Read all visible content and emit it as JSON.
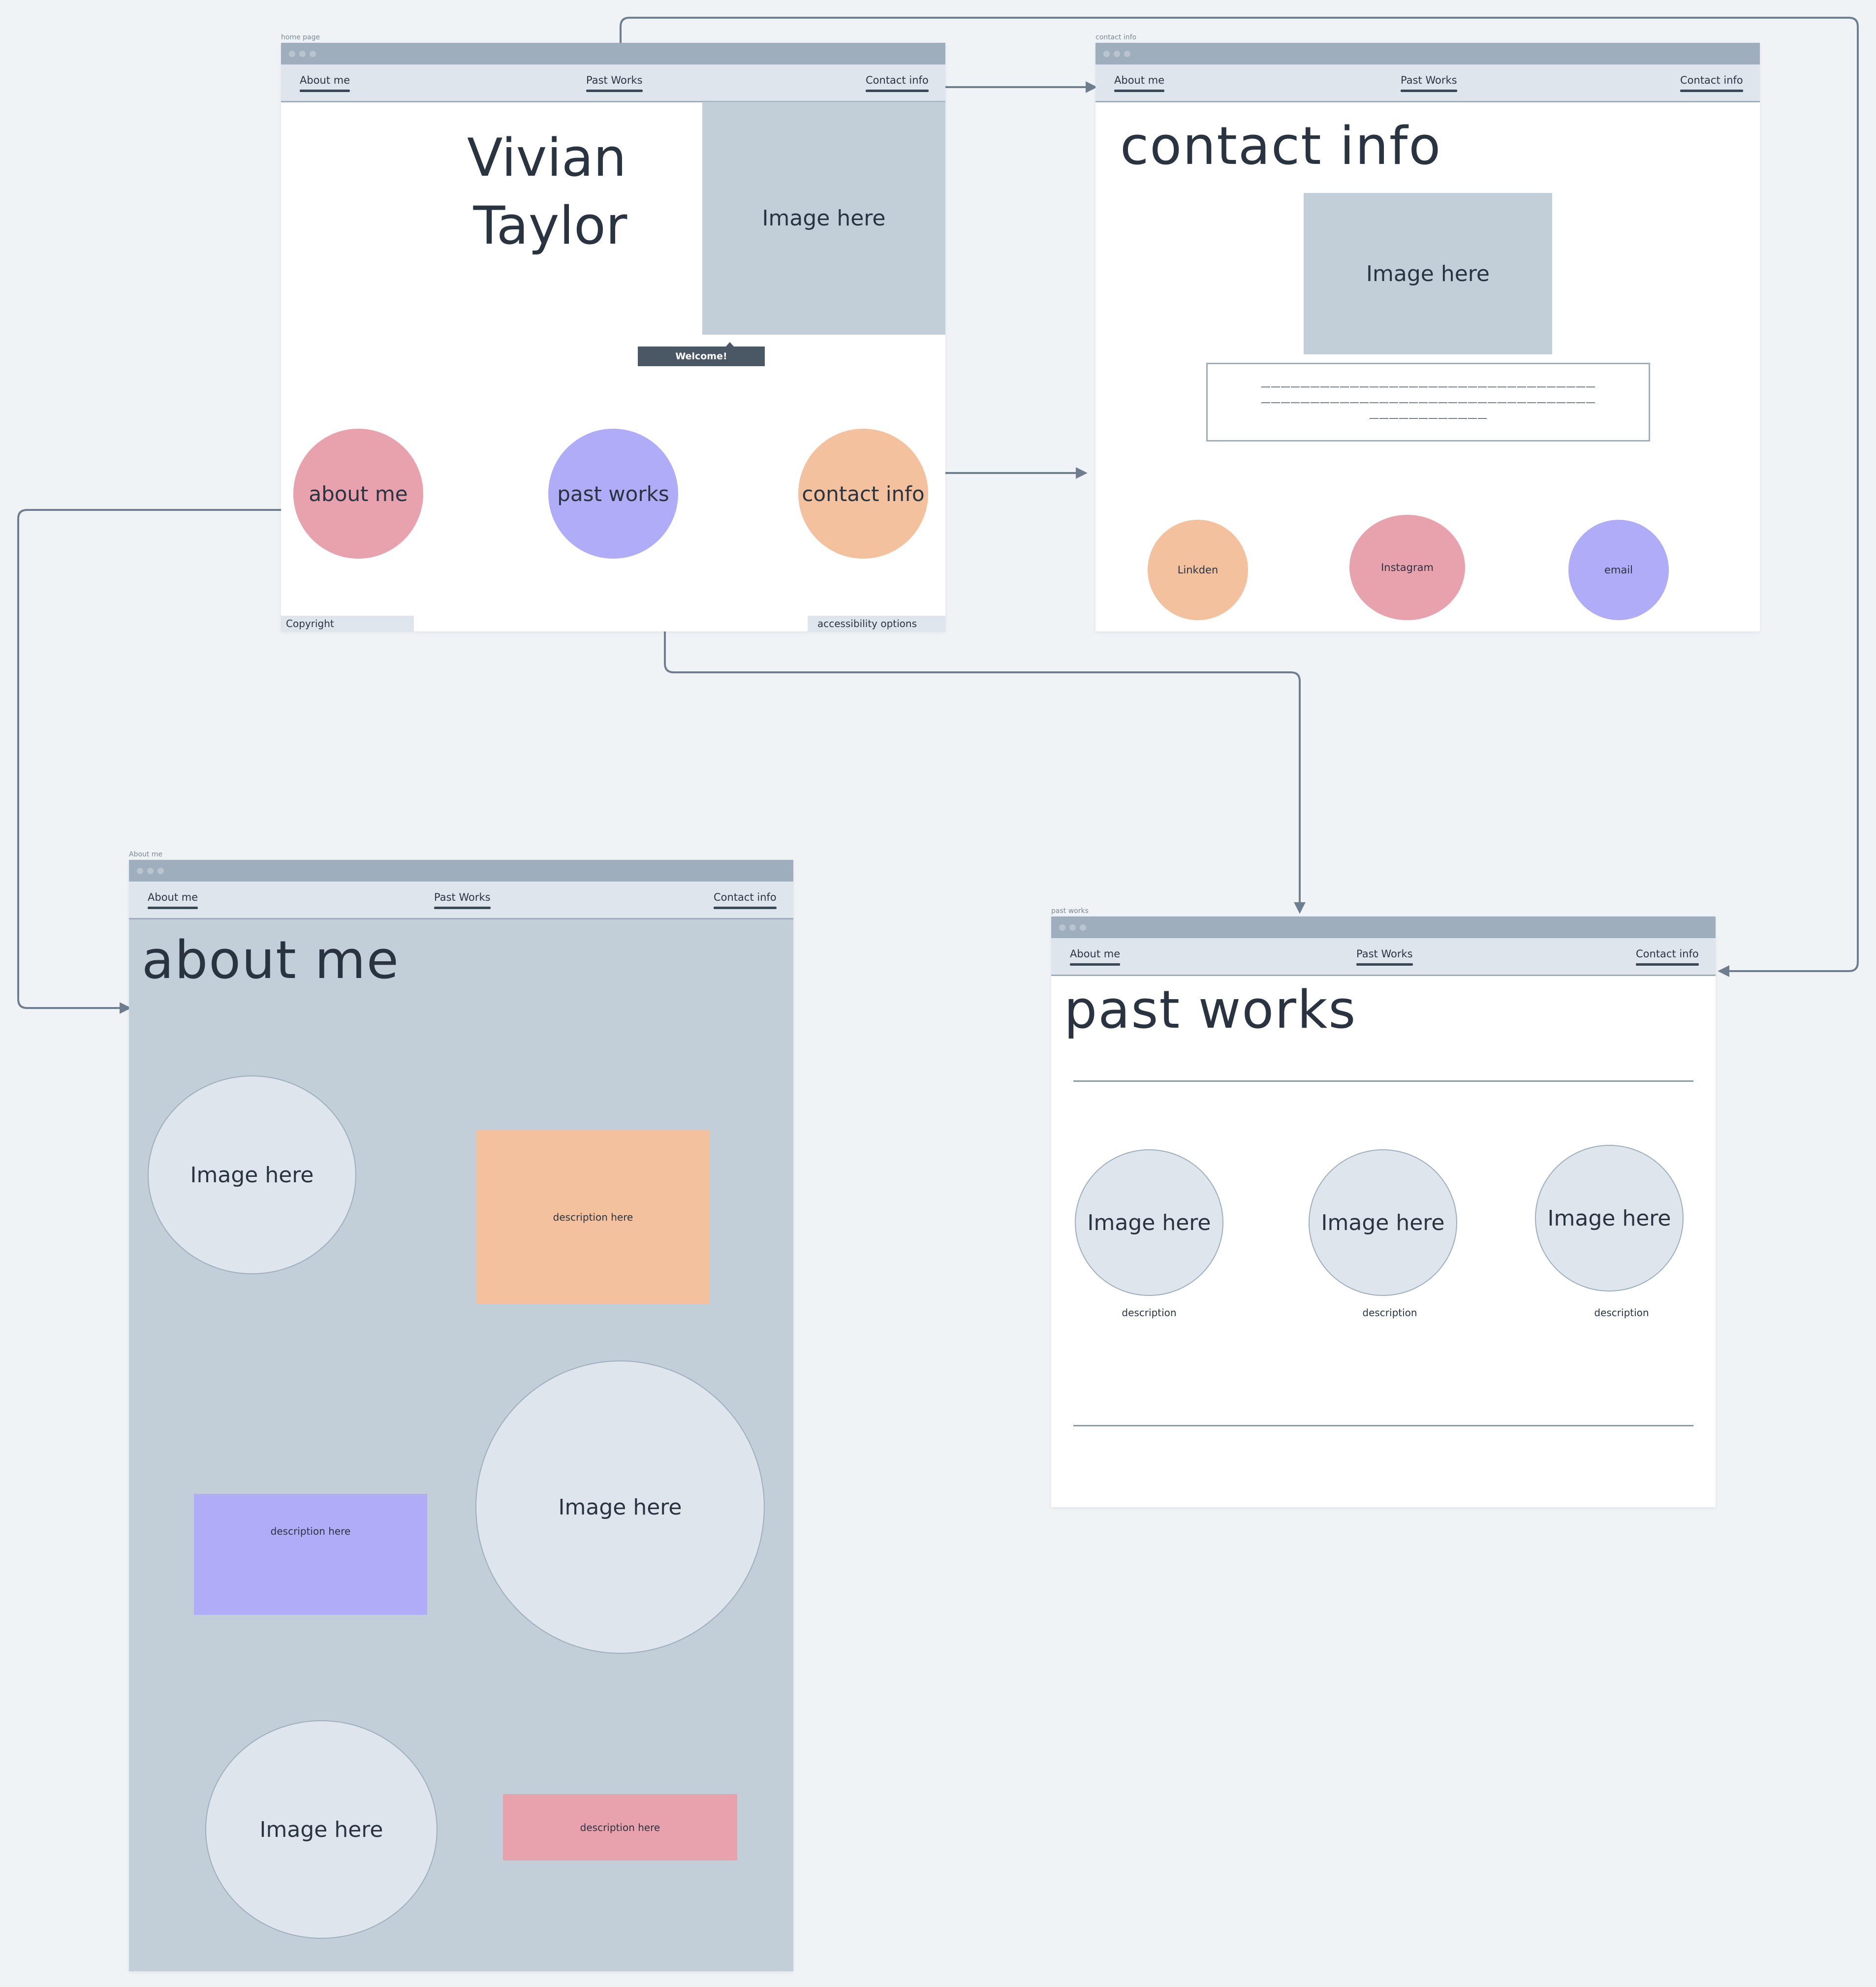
{
  "colors": {
    "canvas": "#eff3f6",
    "titlebar": "#9eaebc",
    "navbar": "#dfe5ec",
    "image_placeholder": "#c3cfd8",
    "image_circle": "#dfe5ec",
    "pink": "#e8a2ad",
    "purple": "#b1acf8",
    "orange": "#f3c19e",
    "connector": "#6e7e8e"
  },
  "nav": {
    "about": "About me",
    "past": "Past Works",
    "contact": "Contact info"
  },
  "home": {
    "frame_label": "home page",
    "name_line1": "Vivian",
    "name_line2": "Taylor",
    "image": "Image here",
    "welcome": "Welcome!",
    "circle_about": "about me",
    "circle_past": "past works",
    "circle_contact": "contact info",
    "copyright": "Copyright",
    "accessibility": "accessibility options"
  },
  "contact": {
    "frame_label": "contact info",
    "heading": "contact info",
    "image": "Image here",
    "text_line1": "——————————————————————————————————",
    "text_line2": "——————————————————————————————————",
    "text_line3": "————————————",
    "linkedin": "Linkden",
    "instagram": "Instagram",
    "email": "email"
  },
  "about": {
    "frame_label": "About me",
    "heading": "about me",
    "image1": "Image here",
    "image2": "Image here",
    "image3": "Image here",
    "desc1": "description here",
    "desc2": "description here",
    "desc3": "description here"
  },
  "past": {
    "frame_label": "past works",
    "heading": "past works",
    "image1": "Image here",
    "image2": "Image here",
    "image3": "Image here",
    "desc1": "description",
    "desc2": "description",
    "desc3": "description"
  }
}
